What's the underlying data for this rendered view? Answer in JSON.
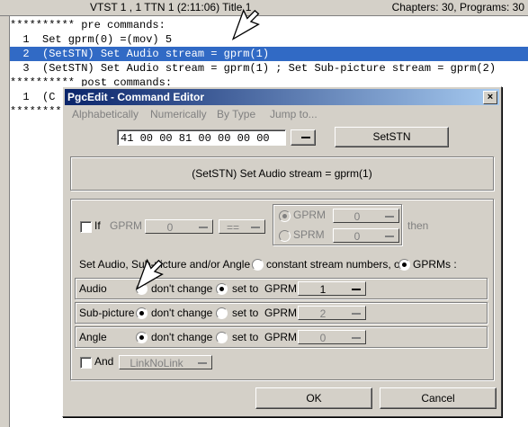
{
  "header": {
    "left": "VTST 1 , 1   TTN 1  (2:11:06)  Title 1",
    "right": "Chapters: 30,  Programs: 30"
  },
  "code_lines": [
    "********** pre commands:",
    "  1  Set gprm(0) =(mov) 5",
    "  2  (SetSTN) Set Audio stream = gprm(1)",
    "  3  (SetSTN) Set Audio stream = gprm(1) ; Set Sub-picture stream = gprm(2)",
    "********** post commands:",
    "  1  (C",
    "********"
  ],
  "dialog": {
    "title": "PgcEdit - Command Editor",
    "close": "×",
    "menu": [
      "Alphabetically",
      "Numerically",
      "By Type",
      "Jump to..."
    ],
    "hex": "41 00 00 81 00 00 00 00",
    "command_button": "SetSTN",
    "description": "(SetSTN) Set Audio stream = gprm(1)",
    "if_row": {
      "if_label": "If",
      "gprm_label": "GPRM",
      "gprm_value": "0",
      "op_value": "==",
      "opt1": "GPRM",
      "opt1_value": "0",
      "opt2": "SPRM",
      "opt2_value": "0",
      "then": "then"
    },
    "set_line": {
      "prefix": "Set Audio, Sub-picture and/or Angle to",
      "opt_const": "constant stream numbers,  or",
      "opt_gprm": "GPRMs :"
    },
    "rows": [
      {
        "label": "Audio",
        "dont": "don't change",
        "set": "set to",
        "gprm": "GPRM",
        "value": "1"
      },
      {
        "label": "Sub-picture",
        "dont": "don't change",
        "set": "set to",
        "gprm": "GPRM",
        "value": "2"
      },
      {
        "label": "Angle",
        "dont": "don't change",
        "set": "set to",
        "gprm": "GPRM",
        "value": "0"
      }
    ],
    "and_label": "And",
    "and_value": "LinkNoLink",
    "ok": "OK",
    "cancel": "Cancel"
  }
}
